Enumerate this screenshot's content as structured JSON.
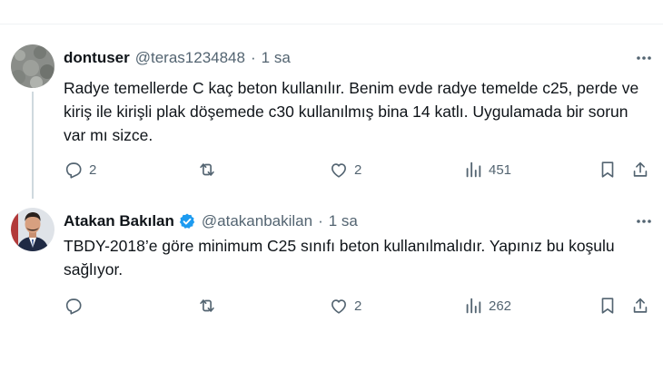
{
  "tweets": [
    {
      "name": "dontuser",
      "handle": "@teras1234848",
      "separator": "·",
      "time": "1 sa",
      "text": "Radye temellerde C kaç beton kullanılır. Benim evde radye temelde c25, perde ve kiriş ile kirişli plak döşemede c30 kullanılmış bina 14 katlı. Uygulamada bir sorun var mı sizce.",
      "replies": "2",
      "retweets": "",
      "likes": "2",
      "views": "451",
      "verified": false
    },
    {
      "name": "Atakan Bakılan",
      "handle": "@atakanbakilan",
      "separator": "·",
      "time": "1 sa",
      "text": "TBDY-2018’e göre minimum C25 sınıfı beton kullanılmalıdır. Yapınız bu koşulu sağlıyor.",
      "replies": "",
      "retweets": "",
      "likes": "2",
      "views": "262",
      "verified": true
    }
  ],
  "colors": {
    "text": "#0f1419",
    "muted": "#536471",
    "verified": "#1d9bf0",
    "thread_line": "#cfd9de"
  },
  "icons": [
    "reply-icon",
    "retweet-icon",
    "like-icon",
    "views-icon",
    "bookmark-icon",
    "share-icon",
    "more-icon",
    "verified-badge-icon"
  ]
}
